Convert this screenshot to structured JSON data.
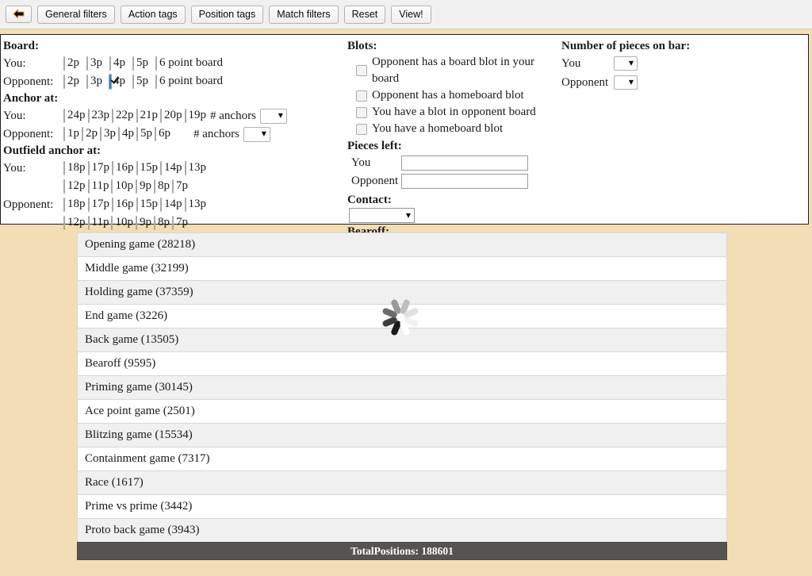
{
  "toolbar": {
    "back_icon": "back-arrow-icon",
    "buttons": [
      "General filters",
      "Action tags",
      "Position tags",
      "Match filters",
      "Reset",
      "View!"
    ]
  },
  "filters": {
    "board": {
      "title": "Board:",
      "you_label": "You:",
      "opponent_label": "Opponent:",
      "options": [
        "2p",
        "3p",
        "4p",
        "5p",
        "6 point board"
      ],
      "you_checked": [
        false,
        false,
        false,
        false,
        false
      ],
      "opponent_checked": [
        false,
        false,
        true,
        false,
        false
      ]
    },
    "anchor": {
      "title": "Anchor at:",
      "you_label": "You:",
      "opponent_label": "Opponent:",
      "you_options": [
        "24p",
        "23p",
        "22p",
        "21p",
        "20p",
        "19p"
      ],
      "opponent_options": [
        "1p",
        "2p",
        "3p",
        "4p",
        "5p",
        "6p"
      ],
      "anchors_label": "# anchors",
      "you_anchors_value": "",
      "opponent_anchors_value": ""
    },
    "outfield": {
      "title": "Outfield anchor at:",
      "you_label": "You:",
      "opponent_label": "Opponent:",
      "row1_options": [
        "18p",
        "17p",
        "16p",
        "15p",
        "14p",
        "13p"
      ],
      "row2_options": [
        "12p",
        "11p",
        "10p",
        "9p",
        "8p",
        "7p"
      ]
    },
    "blots": {
      "title": "Blots:",
      "items": [
        "Opponent has a board blot in your board",
        "Opponent has a homeboard blot",
        "You have a blot in opponent board",
        "You have a homeboard blot"
      ],
      "checked": [
        false,
        false,
        false,
        false
      ]
    },
    "pieces_left": {
      "title": "Pieces left:",
      "you_label": "You",
      "opponent_label": "Opponent",
      "you_value": "",
      "opponent_value": "",
      "placeholder": ""
    },
    "contact": {
      "title": "Contact:",
      "value": ""
    },
    "bearoff": {
      "title": "Bearoff:",
      "value": ""
    },
    "bar": {
      "title": "Number of pieces on bar:",
      "you_label": "You",
      "opponent_label": "Opponent",
      "you_value": "",
      "opponent_value": ""
    }
  },
  "results": {
    "rows": [
      "Opening game (28218)",
      "Middle game (32199)",
      "Holding game (37359)",
      "End game (3226)",
      "Back game (13505)",
      "Bearoff (9595)",
      "Priming game (30145)",
      "Ace point game (2501)",
      "Blitzing game (15534)",
      "Containment game (7317)",
      "Race (1617)",
      "Prime vs prime (3442)",
      "Proto back game (3943)"
    ],
    "total_label": "TotalPositions: 188601"
  },
  "spinner": {
    "name": "loading-spinner",
    "colors": [
      "#1a1a1a",
      "#3d3d3d",
      "#6b6b6b",
      "#999999",
      "#bfbfbf",
      "#e0e0e0",
      "#f2f2f2",
      "#ffffff"
    ]
  },
  "theme": {
    "page_bg": "#f2ddb5",
    "panel_bg": "#ffffff",
    "toolbar_bg": "#f0f0f0",
    "row_alt_bg": "#f0f0f0",
    "totals_bg": "#565452",
    "check_accent": "#3c7fb1"
  }
}
